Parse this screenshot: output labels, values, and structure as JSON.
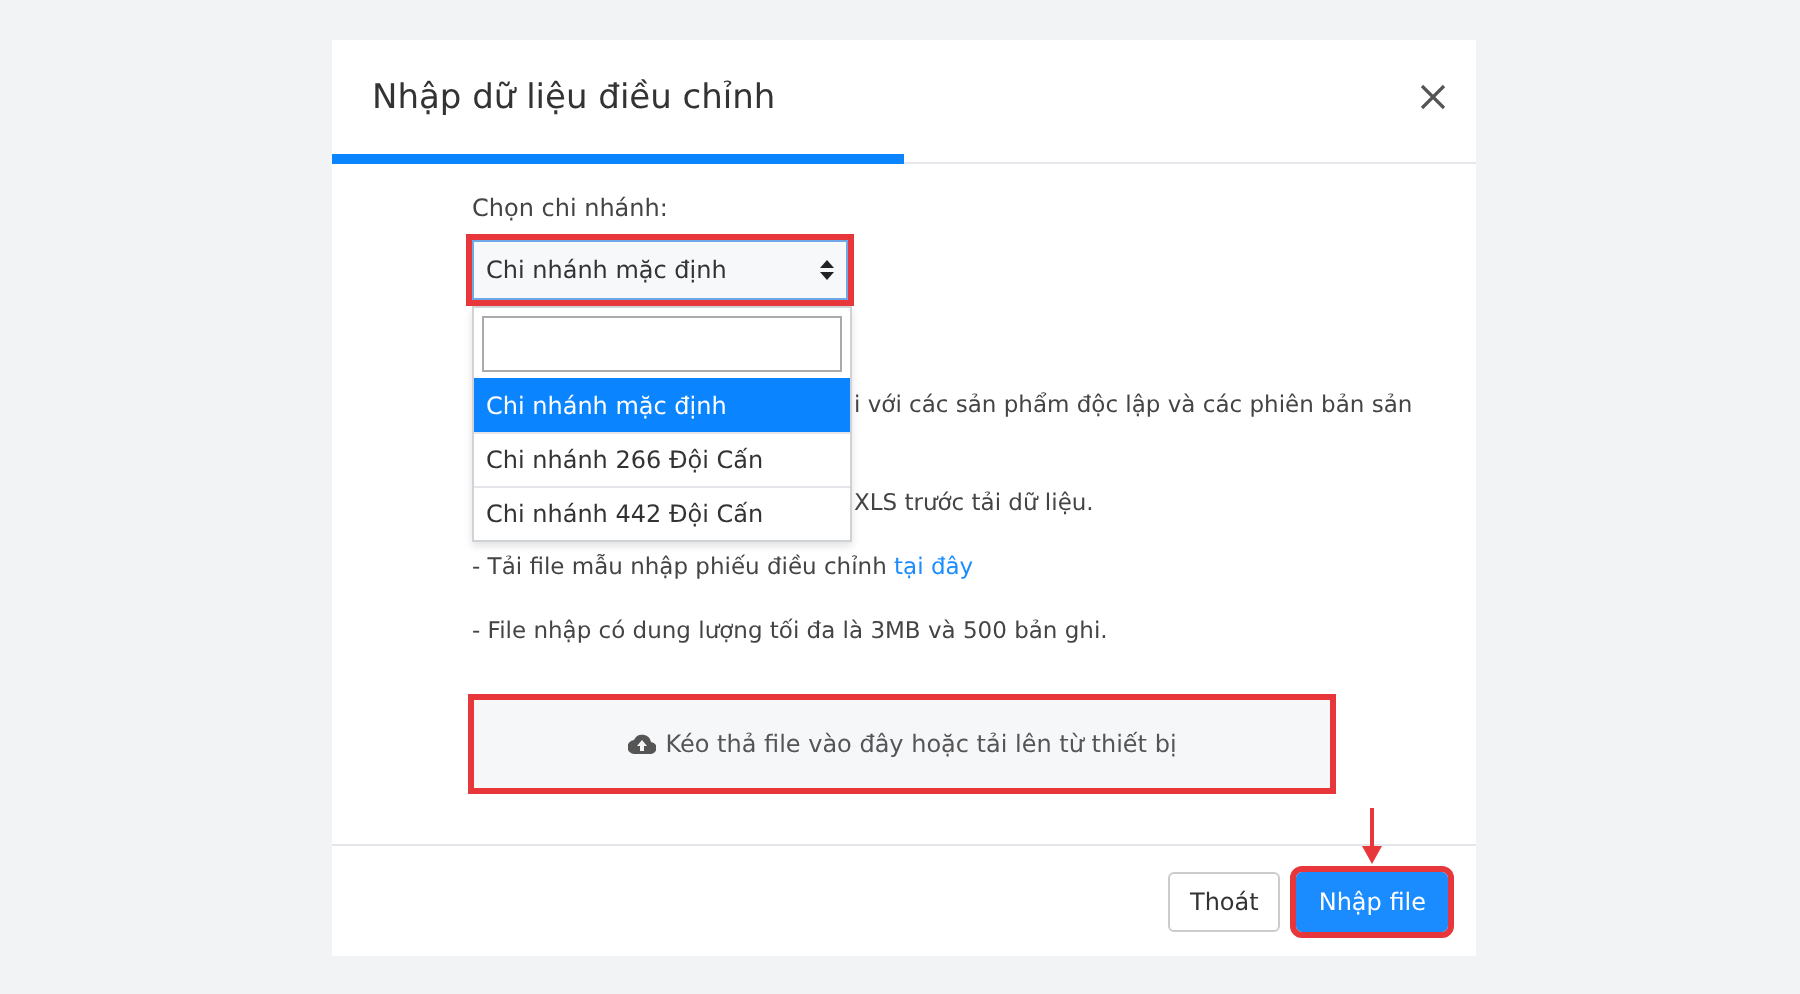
{
  "dialog": {
    "title": "Nhập dữ liệu điều chỉnh"
  },
  "progress": {
    "level": 0.5
  },
  "branch": {
    "label": "Chọn chi nhánh:",
    "value": "Chi nhánh mặc định",
    "highlighted": true,
    "expanded": true,
    "options": [
      {
        "label": "Chi nhánh mặc định",
        "selected": true
      },
      {
        "label": "Chi nhánh 266 Đội Cấn",
        "selected": false
      },
      {
        "label": "Chi nhánh 442 Đội Cấn",
        "selected": false
      }
    ]
  },
  "notes": [
    {
      "kind": "partial",
      "text": "i với các sản phẩm độc lập và các phiên bản sản"
    },
    {
      "kind": "partial",
      "text": "XLS trước tải dữ liệu."
    },
    {
      "kind": "full",
      "text": "- Tải file mẫu nhập phiếu điều chỉnh",
      "link": "tại đây"
    },
    {
      "kind": "full",
      "text": "- File nhập có dung lượng tối đa là 3MB và 500 bản ghi."
    }
  ],
  "upload": {
    "text": "Kéo thả file vào đây hoặc tải lên từ thiết bị",
    "highlighted": true
  },
  "buttons": [
    {
      "label": "Thoát",
      "kind": "secondary",
      "highlighted": false,
      "pointer_arrow": false
    },
    {
      "label": "Nhập file",
      "kind": "primary",
      "highlighted": true,
      "pointer_arrow": true
    }
  ]
}
